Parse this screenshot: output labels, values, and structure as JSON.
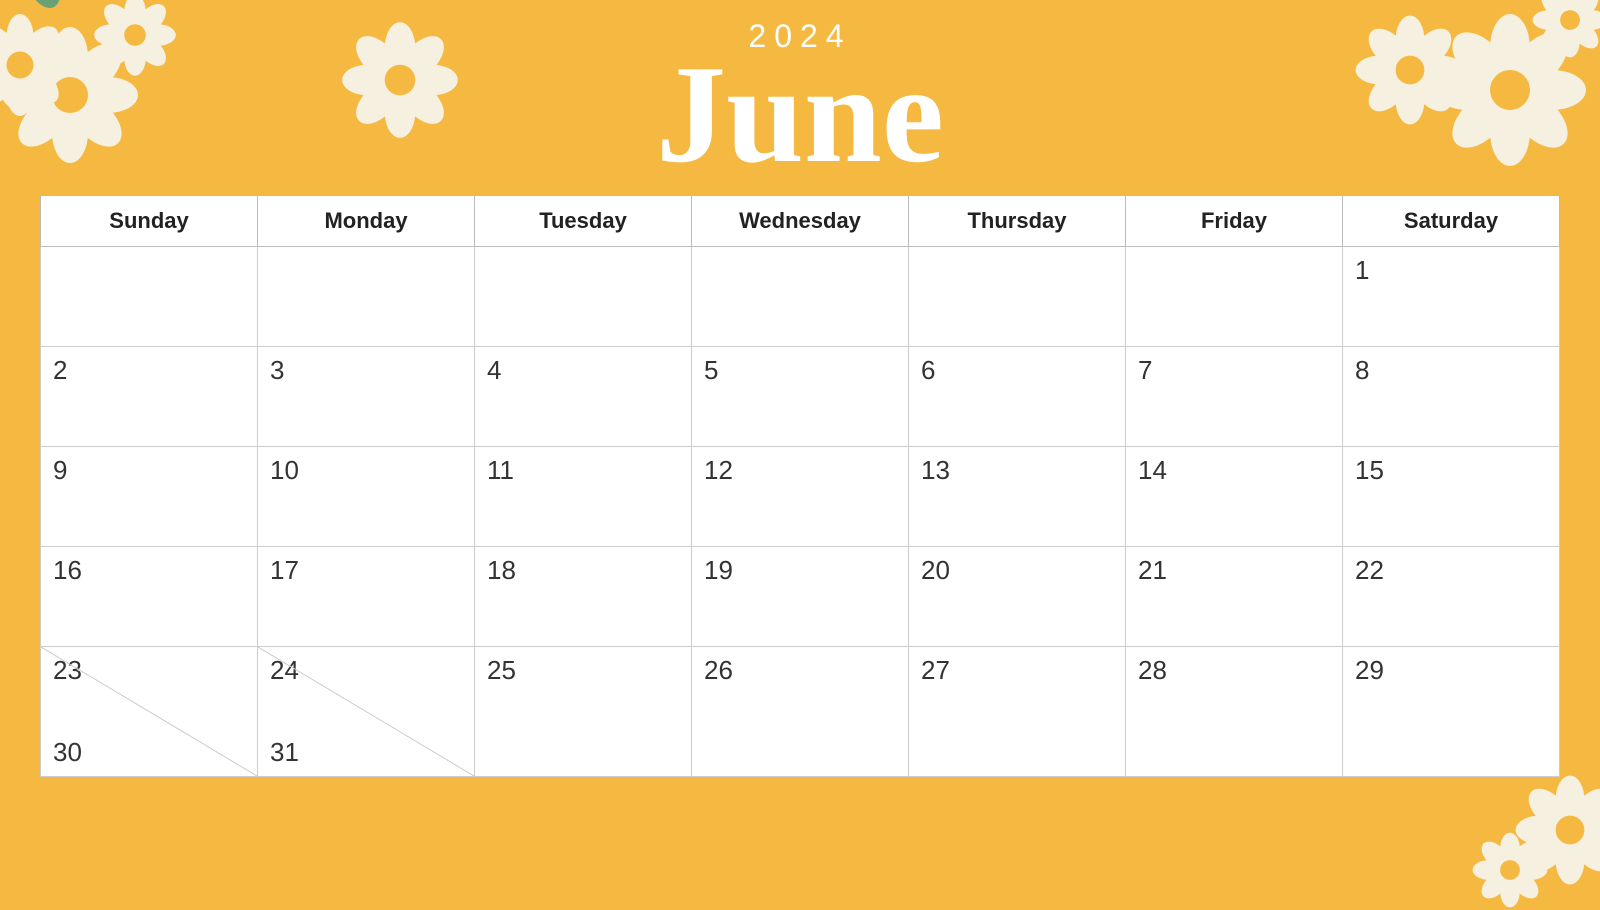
{
  "header": {
    "year": "2024",
    "month": "June"
  },
  "weekdays": [
    "Sunday",
    "Monday",
    "Tuesday",
    "Wednesday",
    "Thursday",
    "Friday",
    "Saturday"
  ],
  "weeks": [
    [
      "",
      "",
      "",
      "",
      "",
      "",
      "1"
    ],
    [
      "2",
      "3",
      "4",
      "5",
      "6",
      "7",
      "8"
    ],
    [
      "9",
      "10",
      "11",
      "12",
      "13",
      "14",
      "15"
    ],
    [
      "16",
      "17",
      "18",
      "19",
      "20",
      "21",
      "22"
    ],
    [
      "23/30",
      "24/31",
      "25",
      "26",
      "27",
      "28",
      "29"
    ]
  ],
  "colors": {
    "background": "#F5B942",
    "white": "#FFFFFF",
    "text_dark": "#333333",
    "border": "#BBBBBB"
  }
}
